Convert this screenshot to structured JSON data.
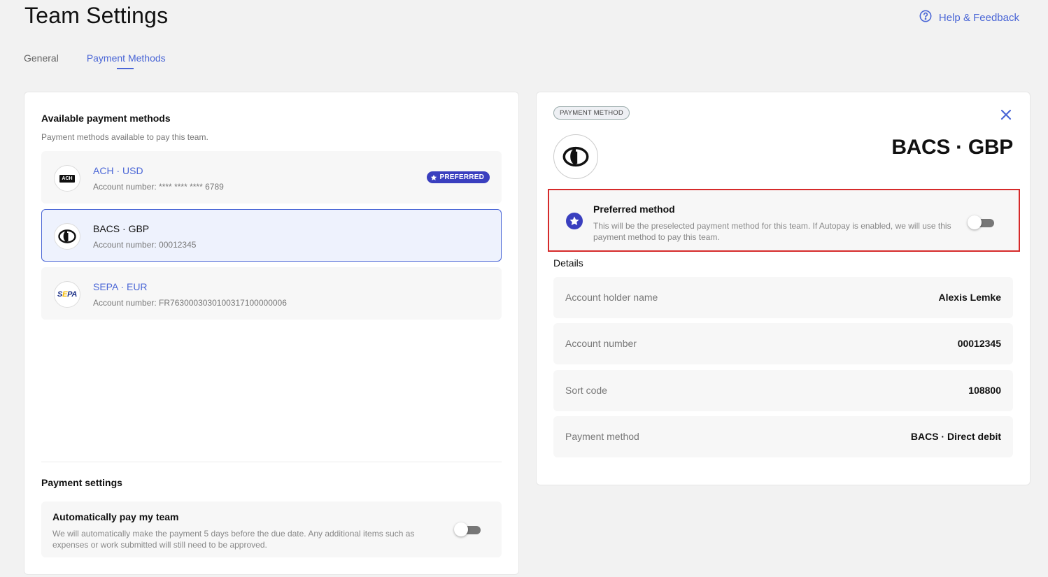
{
  "header": {
    "title": "Team Settings",
    "help_label": "Help & Feedback"
  },
  "tabs": [
    {
      "label": "General",
      "active": false
    },
    {
      "label": "Payment Methods",
      "active": true
    }
  ],
  "available": {
    "title": "Available payment methods",
    "subtitle": "Payment methods available to pay this team.",
    "items": [
      {
        "name": "ACH · USD",
        "account": "Account number: **** **** **** 6789",
        "badge": "PREFERRED",
        "logo_text": "ACH",
        "selected": false
      },
      {
        "name": "BACS · GBP",
        "account": "Account number: 00012345",
        "badge": null,
        "selected": true
      },
      {
        "name": "SEPA · EUR",
        "account": "Account number: FR7630003030100317100000006",
        "badge": null,
        "logo_text": "SEPA",
        "selected": false
      }
    ]
  },
  "payment_settings": {
    "title": "Payment settings",
    "autopay_title": "Automatically pay my team",
    "autopay_desc": "We will automatically make the payment 5 days before the due date. Any additional items such as expenses or work submitted will still need to be approved.",
    "autopay_enabled": false
  },
  "detail_panel": {
    "tag": "PAYMENT METHOD",
    "title": "BACS · GBP",
    "preferred_title": "Preferred method",
    "preferred_desc": "This will be the preselected payment method for this team. If Autopay is enabled, we will use this payment method to pay this team.",
    "preferred_enabled": false,
    "details_label": "Details",
    "rows": [
      {
        "key": "Account holder name",
        "value": "Alexis Lemke"
      },
      {
        "key": "Account number",
        "value": "00012345"
      },
      {
        "key": "Sort code",
        "value": "108800"
      },
      {
        "key": "Payment method",
        "value": "BACS · Direct debit"
      }
    ]
  },
  "colors": {
    "accent": "#4a66d6",
    "badge": "#3a3fbf",
    "highlight": "#d62a2a"
  }
}
